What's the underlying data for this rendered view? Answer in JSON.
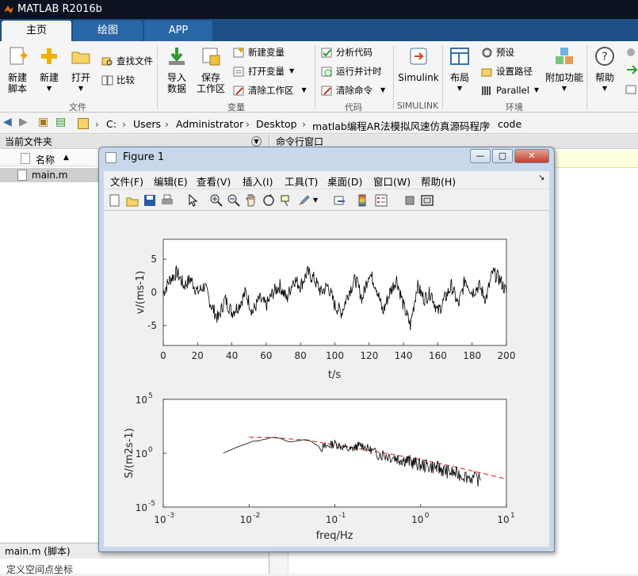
{
  "app": {
    "title": "MATLAB R2016b"
  },
  "tabs": [
    {
      "label": "主页"
    },
    {
      "label": "绘图"
    },
    {
      "label": "APP"
    }
  ],
  "ribbon": {
    "file": {
      "new_script": "新建\n脚本",
      "new": "新建",
      "open": "打开",
      "find_files": "查找文件",
      "compare": "比较",
      "group": "文件"
    },
    "variable": {
      "import": "导入\n数据",
      "save_ws": "保存\n工作区",
      "new_var": "新建变量",
      "open_var": "打开变量",
      "clear_ws": "清除工作区",
      "group": "变量"
    },
    "code": {
      "analyze": "分析代码",
      "run_time": "运行并计时",
      "clear_cmd": "清除命令",
      "group": "代码"
    },
    "simulink": {
      "label": "Simulink",
      "group": "SIMULINK"
    },
    "env": {
      "layout": "布局",
      "prefs": "预设",
      "set_path": "设置路径",
      "parallel": "Parallel",
      "addons": "附加功能",
      "group": "环境"
    },
    "help": {
      "label": "帮助"
    }
  },
  "address": {
    "crumbs": [
      "C:",
      "Users",
      "Administrator",
      "Desktop",
      "matlab编程AR法模拟风速仿真源码程序",
      "code"
    ]
  },
  "left_panel": {
    "title": "当前文件夹",
    "col_name": "名称",
    "sort": "▲",
    "files": [
      "main.m"
    ],
    "details_title": "main.m  (脚本)",
    "details_text": "定义空间点坐标"
  },
  "cmd_panel": {
    "title": "命令行窗口"
  },
  "figure": {
    "title": "Figure 1",
    "menu": [
      "文件(F)",
      "编辑(E)",
      "查看(V)",
      "插入(I)",
      "工具(T)",
      "桌面(D)",
      "窗口(W)",
      "帮助(H)"
    ],
    "plot1": {
      "xlabel": "t/s",
      "ylabel": "v/(ms-1)",
      "xticks": [
        "0",
        "20",
        "40",
        "60",
        "80",
        "100",
        "120",
        "140",
        "160",
        "180",
        "200"
      ],
      "yticks": [
        "5",
        "0",
        "-5"
      ]
    },
    "plot2": {
      "xlabel": "freq/Hz",
      "ylabel": "S/(m2s-1)",
      "xticks": [
        {
          "base": "10",
          "exp": "-3"
        },
        {
          "base": "10",
          "exp": "-2"
        },
        {
          "base": "10",
          "exp": "-1"
        },
        {
          "base": "10",
          "exp": "0"
        },
        {
          "base": "10",
          "exp": "1"
        }
      ],
      "yticks": [
        {
          "base": "10",
          "exp": "5"
        },
        {
          "base": "10",
          "exp": "0"
        },
        {
          "base": "10",
          "exp": "-5"
        }
      ]
    }
  },
  "chart_data": [
    {
      "type": "line",
      "xlim": [
        0,
        200
      ],
      "ylim": [
        -8,
        8
      ],
      "x": [
        0,
        4,
        8,
        12,
        16,
        20,
        24,
        28,
        32,
        36,
        40,
        44,
        48,
        52,
        56,
        60,
        64,
        68,
        72,
        76,
        80,
        84,
        88,
        92,
        96,
        100,
        104,
        108,
        112,
        116,
        120,
        124,
        128,
        132,
        136,
        140,
        144,
        148,
        152,
        156,
        160,
        164,
        168,
        172,
        176,
        180,
        184,
        188,
        192,
        196,
        200
      ],
      "y": [
        0,
        2,
        3,
        1,
        2,
        0,
        1,
        -2,
        -4,
        -1,
        -3,
        -2,
        0,
        -3,
        -1,
        -2,
        0,
        1,
        -1,
        2,
        1,
        3,
        2,
        0,
        1,
        -2,
        -3,
        0,
        2,
        -1,
        3,
        1,
        -3,
        0,
        2,
        -2,
        -5,
        1,
        -1,
        0,
        -3,
        -1,
        1,
        -2,
        2,
        0,
        1,
        -1,
        3,
        2,
        0
      ]
    },
    {
      "type": "line",
      "xscale": "log",
      "yscale": "log",
      "xlim": [
        0.001,
        10
      ],
      "ylim": [
        1e-05,
        100000.0
      ],
      "series": [
        {
          "kind": "simulated",
          "color": "#000000",
          "x": [
            0.005,
            0.01,
            0.015,
            0.02,
            0.03,
            0.05,
            0.07,
            0.1,
            0.15,
            0.2,
            0.3,
            0.5,
            0.7,
            1,
            1.5,
            2,
            3,
            5
          ],
          "y": [
            1,
            10,
            20,
            30,
            12,
            18,
            3,
            8,
            2,
            6,
            1.2,
            0.4,
            0.2,
            0.08,
            0.05,
            0.02,
            0.01,
            0.003
          ]
        },
        {
          "kind": "target",
          "color": "#e03030",
          "style": "dashed",
          "x": [
            0.01,
            0.02,
            0.05,
            0.1,
            0.2,
            0.5,
            1,
            2,
            5,
            10
          ],
          "y": [
            30,
            28,
            15,
            6,
            2.5,
            0.7,
            0.25,
            0.08,
            0.015,
            0.004
          ]
        }
      ]
    }
  ]
}
